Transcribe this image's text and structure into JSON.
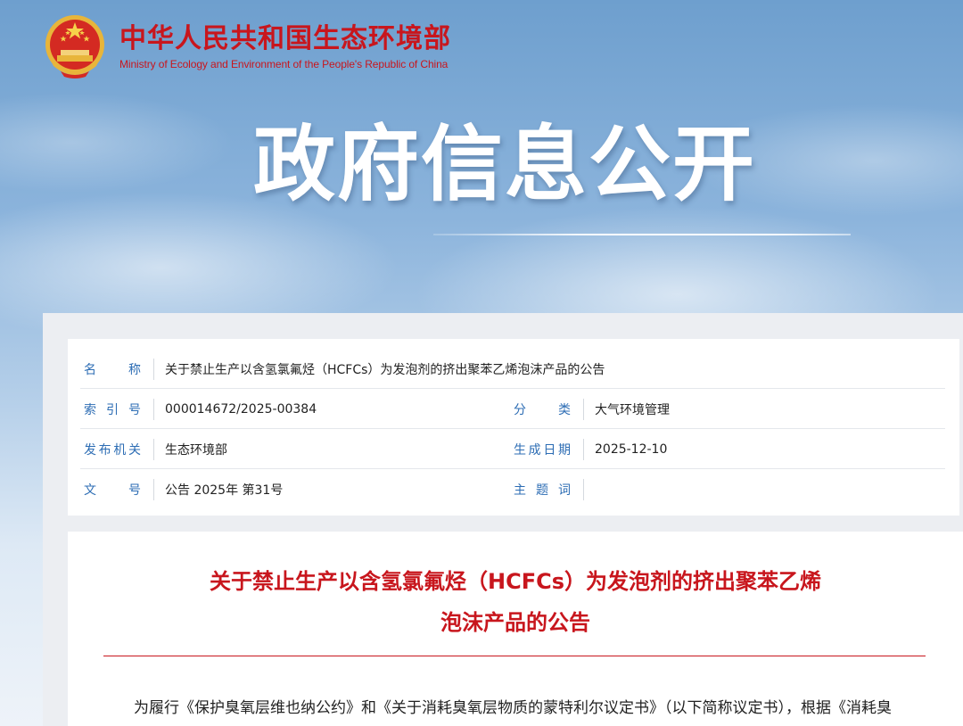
{
  "header": {
    "org_name_cn": "中华人民共和国生态环境部",
    "org_name_en": "Ministry of Ecology and Environment of the People's Republic of China"
  },
  "banner": {
    "title": "政府信息公开"
  },
  "meta": {
    "name_label": "名　　称",
    "name_value": "关于禁止生产以含氢氯氟烃（HCFCs）为发泡剂的挤出聚苯乙烯泡沫产品的公告",
    "index_label": "索 引 号",
    "index_value": "000014672/2025-00384",
    "category_label": "分　　类",
    "category_value": "大气环境管理",
    "issuer_label": "发布机关",
    "issuer_value": "生态环境部",
    "date_label": "生成日期",
    "date_value": "2025-12-10",
    "doc_no_label": "文　　号",
    "doc_no_value": "公告 2025年 第31号",
    "keywords_label": "主 题 词",
    "keywords_value": ""
  },
  "article": {
    "title_line1": "关于禁止生产以含氢氯氟烃（HCFCs）为发泡剂的挤出聚苯乙烯",
    "title_line2": "泡沫产品的公告",
    "body_first_line": "为履行《保护臭氧层维也纳公约》和《关于消耗臭氧层物质的蒙特利尔议定书》（以下简称议定书），根据《消耗臭"
  },
  "colors": {
    "brand_red": "#c8161d",
    "label_blue": "#2d6db4"
  },
  "icons": {
    "emblem": "national-emblem-icon"
  }
}
